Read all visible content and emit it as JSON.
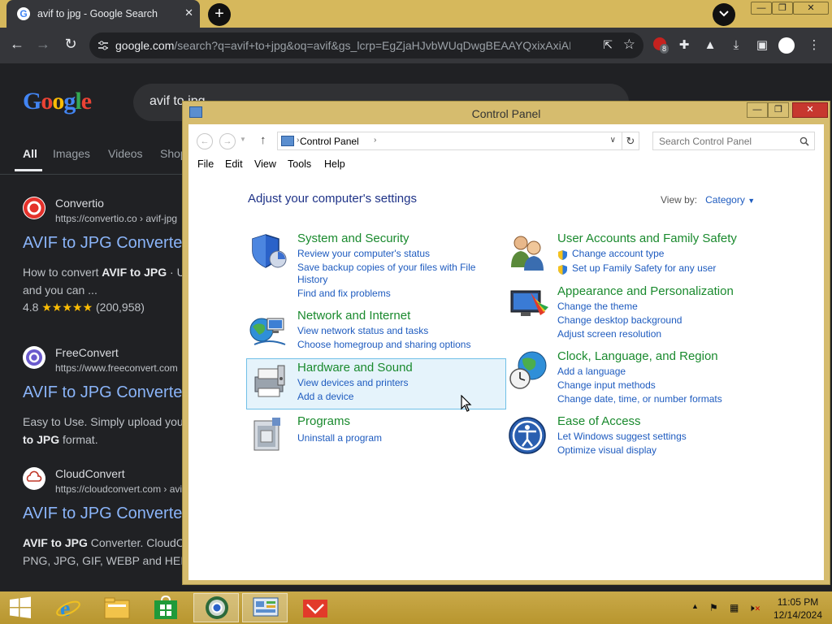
{
  "browser": {
    "tab_title": "avif to jpg - Google Search",
    "tab_favicon": "G",
    "url_host": "google.com",
    "url_rest": "/search?q=avif+to+jpg&oq=avif&gs_lcrp=EgZjaHJvbWUqDwgBEAAYQxixAxiABBi...",
    "extension_badge": "8",
    "new_tab": "+",
    "search_query": "avif to jpg",
    "google_logo": "Google",
    "tabs": [
      "All",
      "Images",
      "Videos",
      "Shop"
    ],
    "results": [
      {
        "name": "Convertio",
        "cite": "https://convertio.co › avif-jpg",
        "title": "AVIF to JPG Converter",
        "snippet_line1_a": "How to convert ",
        "snippet_line1_b": "AVIF to JPG",
        "snippet_line1_c": " · Upload",
        "snippet_line2": "and you can ...",
        "rating": "4.8",
        "stars": "★★★★★",
        "rating_count": "(200,958)"
      },
      {
        "name": "FreeConvert",
        "cite": "https://www.freeconvert.com",
        "title": "AVIF to JPG Converter",
        "snippet_line1": "Easy to Use. Simply upload your",
        "snippet_line2_b": "to JPG",
        "snippet_line2_c": " format."
      },
      {
        "name": "CloudConvert",
        "cite": "https://cloudconvert.com › avif",
        "title": "AVIF to JPG Converter",
        "snippet_line1_b": "AVIF to JPG",
        "snippet_line1_c": " Converter. CloudConvert",
        "snippet_line2": "PNG, JPG, GIF, WEBP and HEIC."
      }
    ]
  },
  "control_panel": {
    "window_title": "Control Panel",
    "breadcrumb": "Control Panel",
    "search_placeholder": "Search Control Panel",
    "menu": [
      "File",
      "Edit",
      "View",
      "Tools",
      "Help"
    ],
    "heading": "Adjust your computer's settings",
    "view_by_label": "View by:",
    "view_by_value": "Category",
    "categories": [
      {
        "title": "System and Security",
        "icon": "shield-icon",
        "links": [
          "Review your computer's status",
          "Save backup copies of your files with File",
          "History",
          "Find and fix problems"
        ]
      },
      {
        "title": "Network and Internet",
        "icon": "network-icon",
        "links": [
          "View network status and tasks",
          "Choose homegroup and sharing options"
        ]
      },
      {
        "title": "Hardware and Sound",
        "icon": "printer-icon",
        "links": [
          "View devices and printers",
          "Add a device"
        ]
      },
      {
        "title": "Programs",
        "icon": "programs-icon",
        "links": [
          "Uninstall a program"
        ]
      },
      {
        "title": "User Accounts and Family Safety",
        "icon": "users-icon",
        "links": [
          "Change account type",
          "Set up Family Safety for any user"
        ]
      },
      {
        "title": "Appearance and Personalization",
        "icon": "monitor-icon",
        "links": [
          "Change the theme",
          "Change desktop background",
          "Adjust screen resolution"
        ]
      },
      {
        "title": "Clock, Language, and Region",
        "icon": "globe-clock-icon",
        "links": [
          "Add a language",
          "Change input methods",
          "Change date, time, or number formats"
        ]
      },
      {
        "title": "Ease of Access",
        "icon": "ease-of-access-icon",
        "links": [
          "Let Windows suggest settings",
          "Optimize visual display"
        ]
      }
    ]
  },
  "taskbar": {
    "time": "11:05 PM",
    "date": "12/14/2024"
  },
  "colors": {
    "accent_gold": "#d6b85c",
    "link_blue": "#1e5bbf",
    "category_green": "#1a8a2e",
    "heading_blue": "#1e3287",
    "google_link": "#8ab4f8"
  }
}
